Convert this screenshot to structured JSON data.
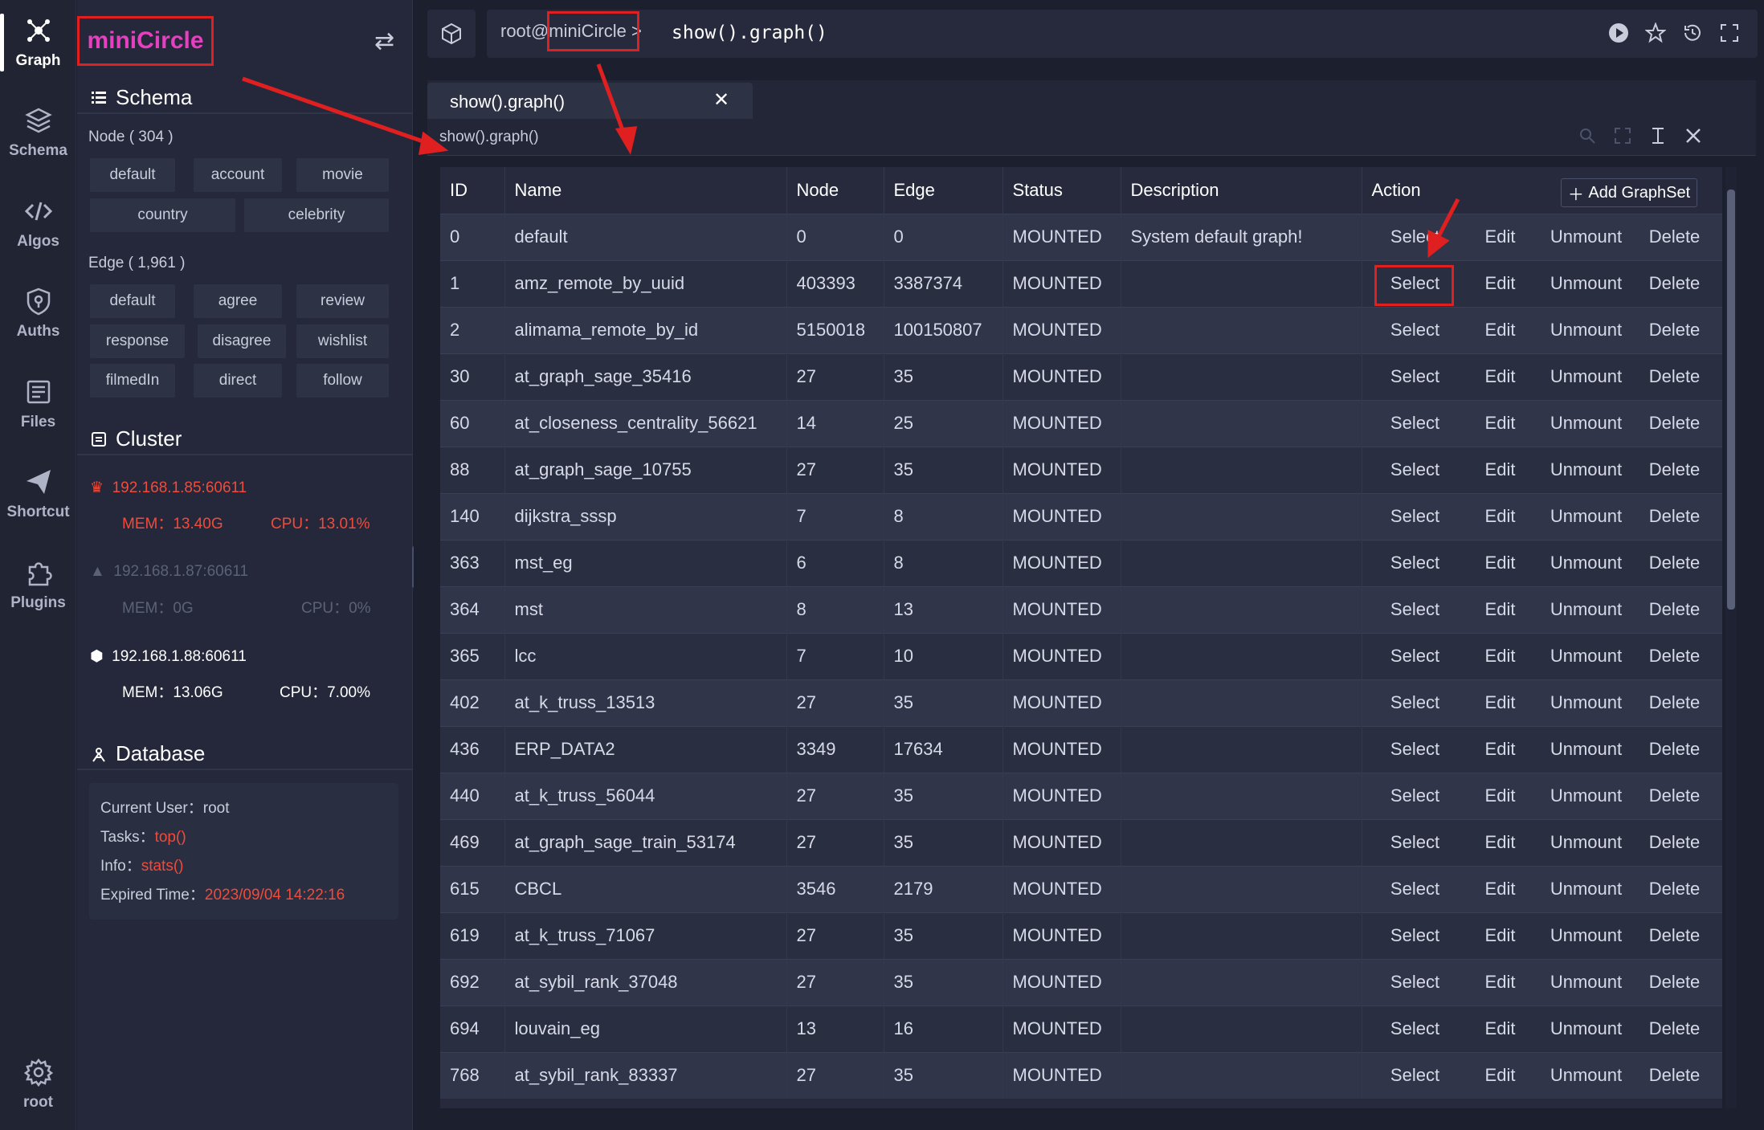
{
  "rail": {
    "items": [
      {
        "label": "Graph",
        "icon": "graph-icon"
      },
      {
        "label": "Schema",
        "icon": "schema-icon"
      },
      {
        "label": "Algos",
        "icon": "code-icon"
      },
      {
        "label": "Auths",
        "icon": "shield-icon"
      },
      {
        "label": "Files",
        "icon": "files-icon"
      },
      {
        "label": "Shortcut",
        "icon": "send-icon"
      },
      {
        "label": "Plugins",
        "icon": "plugin-icon"
      }
    ],
    "user": "root"
  },
  "panel": {
    "logo": "miniCircle",
    "schema": {
      "title": "Schema",
      "node_title": "Node ( 304 )",
      "node_chips": [
        "default",
        "account",
        "movie",
        "country",
        "celebrity"
      ],
      "edge_title": "Edge ( 1,961 )",
      "edge_chips": [
        "default",
        "agree",
        "review",
        "response",
        "disagree",
        "wishlist",
        "filmedIn",
        "direct",
        "follow"
      ]
    },
    "cluster": {
      "title": "Cluster",
      "nodes": [
        {
          "addr": "192.168.1.85:60611",
          "mem": "MEM：13.40G",
          "cpu": "CPU：13.01%",
          "color": "#f04b3b"
        },
        {
          "addr": "192.168.1.87:60611",
          "mem": "MEM：0G",
          "cpu": "CPU：0%",
          "color": "#5c6276"
        },
        {
          "addr": "192.168.1.88:60611",
          "mem": "MEM：13.06G",
          "cpu": "CPU：7.00%",
          "color": "#ffffff"
        }
      ]
    },
    "database": {
      "title": "Database",
      "current_user_label": "Current User：",
      "current_user": "root",
      "tasks_label": "Tasks：",
      "tasks": "top()",
      "info_label": "Info：",
      "info": "stats()",
      "expired_label": "Expired Time：",
      "expired": "2023/09/04 14:22:16"
    }
  },
  "topbar": {
    "prompt_user": "root@",
    "prompt_host": "miniCircle",
    "prompt_sep": ">",
    "command": "show().graph()"
  },
  "tab": {
    "label": "show().graph()",
    "close": "✕"
  },
  "subbar": {
    "label": "show().graph()"
  },
  "table": {
    "headers": [
      "ID",
      "Name",
      "Node",
      "Edge",
      "Status",
      "Description",
      "Action"
    ],
    "add_label": "Add GraphSet",
    "actions": [
      "Select",
      "Edit",
      "Unmount",
      "Delete"
    ],
    "rows": [
      [
        "0",
        "default",
        "0",
        "0",
        "MOUNTED",
        "System default graph!"
      ],
      [
        "1",
        "amz_remote_by_uuid",
        "403393",
        "3387374",
        "MOUNTED",
        ""
      ],
      [
        "2",
        "alimama_remote_by_id",
        "5150018",
        "100150807",
        "MOUNTED",
        ""
      ],
      [
        "30",
        "at_graph_sage_35416",
        "27",
        "35",
        "MOUNTED",
        ""
      ],
      [
        "60",
        "at_closeness_centrality_56621",
        "14",
        "25",
        "MOUNTED",
        ""
      ],
      [
        "88",
        "at_graph_sage_10755",
        "27",
        "35",
        "MOUNTED",
        ""
      ],
      [
        "140",
        "dijkstra_sssp",
        "7",
        "8",
        "MOUNTED",
        ""
      ],
      [
        "363",
        "mst_eg",
        "6",
        "8",
        "MOUNTED",
        ""
      ],
      [
        "364",
        "mst",
        "8",
        "13",
        "MOUNTED",
        ""
      ],
      [
        "365",
        "lcc",
        "7",
        "10",
        "MOUNTED",
        ""
      ],
      [
        "402",
        "at_k_truss_13513",
        "27",
        "35",
        "MOUNTED",
        ""
      ],
      [
        "436",
        "ERP_DATA2",
        "3349",
        "17634",
        "MOUNTED",
        ""
      ],
      [
        "440",
        "at_k_truss_56044",
        "27",
        "35",
        "MOUNTED",
        ""
      ],
      [
        "469",
        "at_graph_sage_train_53174",
        "27",
        "35",
        "MOUNTED",
        ""
      ],
      [
        "615",
        "CBCL",
        "3546",
        "2179",
        "MOUNTED",
        ""
      ],
      [
        "619",
        "at_k_truss_71067",
        "27",
        "35",
        "MOUNTED",
        ""
      ],
      [
        "692",
        "at_sybil_rank_37048",
        "27",
        "35",
        "MOUNTED",
        ""
      ],
      [
        "694",
        "louvain_eg",
        "13",
        "16",
        "MOUNTED",
        ""
      ],
      [
        "768",
        "at_sybil_rank_83337",
        "27",
        "35",
        "MOUNTED",
        ""
      ]
    ]
  }
}
